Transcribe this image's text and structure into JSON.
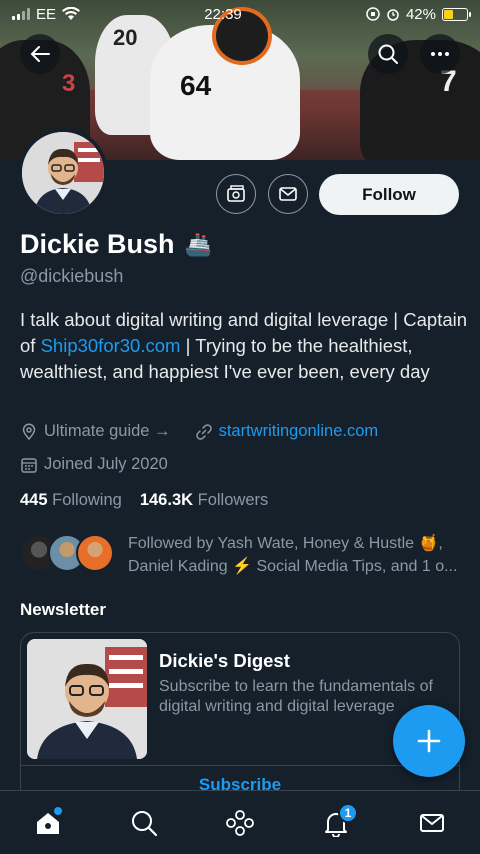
{
  "status_bar": {
    "carrier": "EE",
    "time": "22:39",
    "battery": "42%",
    "battery_level": 0.42
  },
  "profile": {
    "name": "Dickie Bush",
    "name_emoji": "🚢",
    "handle": "@dickiebush",
    "follow_label": "Follow",
    "bio_pre": "I talk about digital writing and digital leverage | Captain of ",
    "bio_link": "Ship30for30.com",
    "bio_post": " | Trying to be the healthiest, wealthiest, and happiest I've ever been, every day",
    "location": "Ultimate guide →",
    "website": "startwritingonline.com",
    "joined": "Joined July 2020",
    "following_count": "445",
    "following_label": "Following",
    "followers_count": "146.3K",
    "followers_label": "Followers",
    "followed_by": "Followed by Yash Wate, Honey & Hustle 🍯, Daniel Kading ⚡ Social Media Tips, and 1 o..."
  },
  "newsletter": {
    "section_title": "Newsletter",
    "title": "Dickie's Digest",
    "description": "Subscribe to learn the fundamentals of digital writing and digital leverage",
    "subscribe_label": "Subscribe"
  },
  "tabs": {
    "notifications_badge": "1"
  },
  "colors": {
    "accent": "#1d9bf0",
    "background": "#15202b",
    "muted": "#8b98a5"
  }
}
